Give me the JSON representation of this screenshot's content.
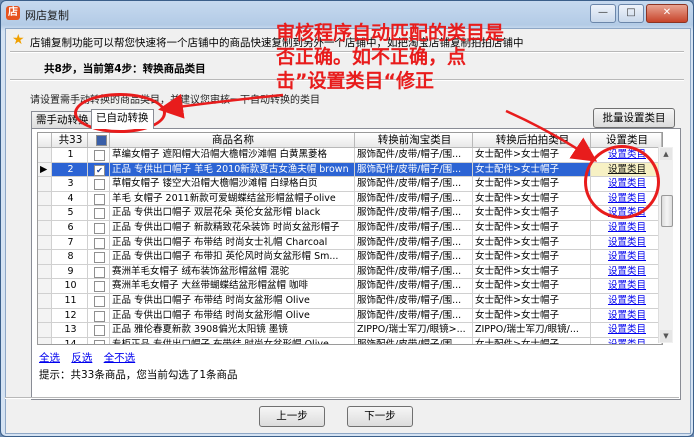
{
  "window": {
    "title": "网店复制",
    "app_icon": "shop-logo",
    "controls": {
      "minimize": "—",
      "maximize": "□",
      "close": "✕"
    }
  },
  "info": {
    "icon": "star-icon",
    "text": "店铺复制功能可以帮您快速将一个店铺中的商品快速复制到另外一个店铺中，如把淘宝店铺复制拍拍店铺中"
  },
  "step": "共8步，当前第4步：转换商品类目",
  "hint": "请设置需手动转换的商品类目，并建议您审核一下自动转换的类目",
  "annotation": {
    "text": "审核程序自动匹配的类目是否正确。如不正确，点击”设置类目“修正",
    "color": "#e81c1c"
  },
  "tabs": [
    {
      "label": "需手动转换",
      "active": false
    },
    {
      "label": "已自动转换",
      "active": true
    }
  ],
  "batch_button": "批量设置类目",
  "table": {
    "headers": {
      "count": "共33",
      "name": "商品名称",
      "before": "转换前淘宝类目",
      "after": "转换后拍拍类目",
      "action": "设置类目"
    },
    "selected_index": 1,
    "rows": [
      {
        "n": "1",
        "checked": false,
        "name": "草编女帽子 遮阳帽大沿帽大檐帽沙滩帽 白黄黑菱格",
        "before": "服饰配件/皮带/帽子/围...",
        "after": "女士配件>女士帽子",
        "action": "设置类目"
      },
      {
        "n": "2",
        "checked": true,
        "name": "正品 专供出口帽子 羊毛 2010新款夏古女渔夫帽 brown",
        "before": "服饰配件/皮带/帽子/围...",
        "after": "女士配件>女士帽子",
        "action": "设置类目"
      },
      {
        "n": "3",
        "checked": false,
        "name": "草帽女帽子 镂空大沿帽大檐帽沙滩帽 白绿格白页",
        "before": "服饰配件/皮带/帽子/围...",
        "after": "女士配件>女士帽子",
        "action": "设置类目"
      },
      {
        "n": "4",
        "checked": false,
        "name": "羊毛 女帽子 2011新款可爱蝴蝶结盆形帽盆帽子olive",
        "before": "服饰配件/皮带/帽子/围...",
        "after": "女士配件>女士帽子",
        "action": "设置类目"
      },
      {
        "n": "5",
        "checked": false,
        "name": "正品 专供出口帽子 双层花朵 英伦女盆形帽 black",
        "before": "服饰配件/皮带/帽子/围...",
        "after": "女士配件>女士帽子",
        "action": "设置类目"
      },
      {
        "n": "6",
        "checked": false,
        "name": "正品 专供出口帽子 新款精致花朵装饰 时尚女盆形帽子",
        "before": "服饰配件/皮带/帽子/围...",
        "after": "女士配件>女士帽子",
        "action": "设置类目"
      },
      {
        "n": "7",
        "checked": false,
        "name": "正品 专供出口帽子 布带结 时尚女士礼帽 Charcoal",
        "before": "服饰配件/皮带/帽子/围...",
        "after": "女士配件>女士帽子",
        "action": "设置类目"
      },
      {
        "n": "8",
        "checked": false,
        "name": "正品 专供出口帽子 布带扣 英伦风时尚女盆形帽 Sm...",
        "before": "服饰配件/皮带/帽子/围...",
        "after": "女士配件>女士帽子",
        "action": "设置类目"
      },
      {
        "n": "9",
        "checked": false,
        "name": "赛洲羊毛女帽子 绒布装饰盆形帽盆帽 混驼",
        "before": "服饰配件/皮带/帽子/围...",
        "after": "女士配件>女士帽子",
        "action": "设置类目"
      },
      {
        "n": "10",
        "checked": false,
        "name": "赛洲羊毛女帽子 大丝带蝴蝶结盆形帽盆帽 咖啡",
        "before": "服饰配件/皮带/帽子/围...",
        "after": "女士配件>女士帽子",
        "action": "设置类目"
      },
      {
        "n": "11",
        "checked": false,
        "name": "正品 专供出口帽子 布带结 时尚女盆形帽 Olive",
        "before": "服饰配件/皮带/帽子/围...",
        "after": "女士配件>女士帽子",
        "action": "设置类目"
      },
      {
        "n": "12",
        "checked": false,
        "name": "正品 专供出口帽子 布带结 时尚女盆形帽 Olive",
        "before": "服饰配件/皮带/帽子/围...",
        "after": "女士配件>女士帽子",
        "action": "设置类目"
      },
      {
        "n": "13",
        "checked": false,
        "name": "正品 雅伦春夏新款 3908偏光太阳镜 墨镜",
        "before": "ZIPPO/瑞士军刀/眼镜>...",
        "after": "ZIPPO/瑞士军刀/眼镜/...",
        "action": "设置类目"
      },
      {
        "n": "14",
        "checked": false,
        "name": "专柜正品 专供出口帽子 布带结 时尚女盆形帽 Olive",
        "before": "服饰配件/皮带/帽子/围...",
        "after": "女士配件>女士帽子",
        "action": "设置类目"
      }
    ]
  },
  "selection_links": [
    "全选",
    "反选",
    "全不选"
  ],
  "tip": "提示：共33条商品，您当前勾选了1条商品",
  "nav": {
    "prev": "上一步",
    "next": "下一步"
  }
}
